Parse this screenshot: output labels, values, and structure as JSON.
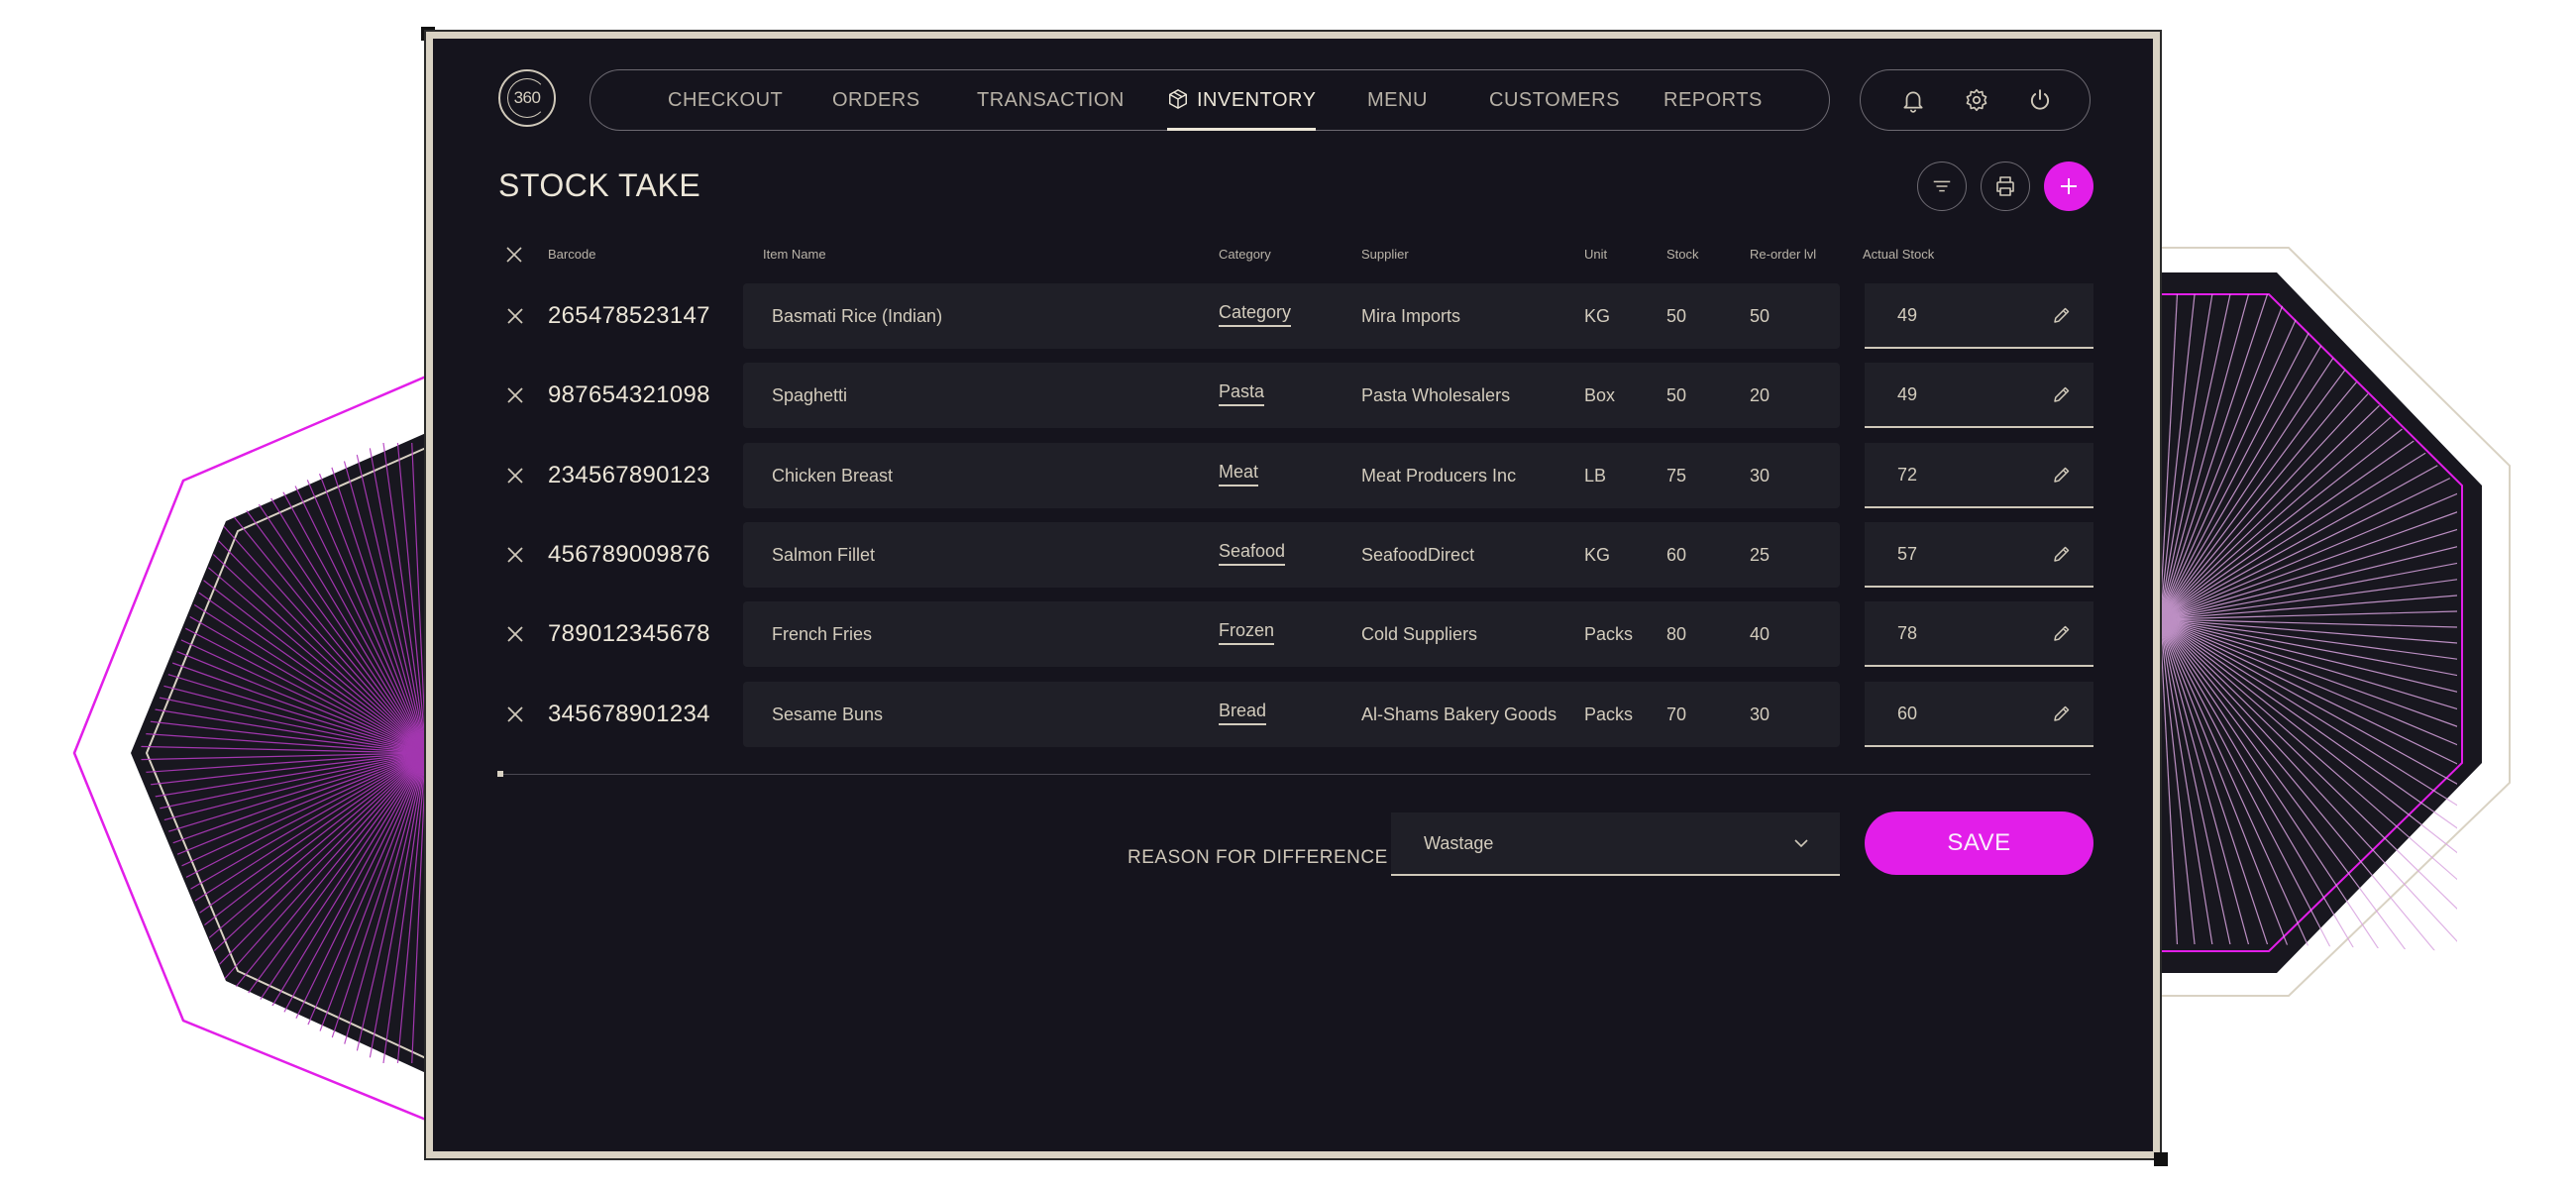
{
  "app": {
    "logo_text": "360"
  },
  "nav": {
    "items": [
      {
        "label": "CHECKOUT",
        "active": false
      },
      {
        "label": "ORDERS",
        "active": false
      },
      {
        "label": "TRANSACTION",
        "active": false
      },
      {
        "label": "INVENTORY",
        "active": true
      },
      {
        "label": "MENU",
        "active": false
      },
      {
        "label": "CUSTOMERS",
        "active": false
      },
      {
        "label": "REPORTS",
        "active": false
      }
    ]
  },
  "header_actions": [
    "bell-icon",
    "gear-icon",
    "power-icon"
  ],
  "page": {
    "title": "STOCK TAKE"
  },
  "toolbar": [
    "filter-icon",
    "printer-icon",
    "plus-icon"
  ],
  "table": {
    "columns": {
      "barcode": "Barcode",
      "item_name": "Item Name",
      "category": "Category",
      "supplier": "Supplier",
      "unit": "Unit",
      "stock": "Stock",
      "reorder": "Re-order lvl",
      "actual": "Actual Stock"
    },
    "rows": [
      {
        "barcode": "265478523147",
        "item_name": "Basmati Rice (Indian)",
        "category": "Category",
        "supplier": "Mira Imports",
        "unit": "KG",
        "stock": "50",
        "reorder": "50",
        "actual": "49"
      },
      {
        "barcode": "987654321098",
        "item_name": "Spaghetti",
        "category": "Pasta",
        "supplier": "Pasta Wholesalers",
        "unit": "Box",
        "stock": "50",
        "reorder": "20",
        "actual": "49"
      },
      {
        "barcode": "234567890123",
        "item_name": "Chicken Breast",
        "category": "Meat",
        "supplier": "Meat Producers Inc",
        "unit": "LB",
        "stock": "75",
        "reorder": "30",
        "actual": "72"
      },
      {
        "barcode": "456789009876",
        "item_name": "Salmon Fillet",
        "category": "Seafood",
        "supplier": "SeafoodDirect",
        "unit": "KG",
        "stock": "60",
        "reorder": "25",
        "actual": "57"
      },
      {
        "barcode": "789012345678",
        "item_name": "French Fries",
        "category": "Frozen",
        "supplier": "Cold Suppliers",
        "unit": "Packs",
        "stock": "80",
        "reorder": "40",
        "actual": "78"
      },
      {
        "barcode": "345678901234",
        "item_name": "Sesame Buns",
        "category": "Bread",
        "supplier": "Al-Shams Bakery Goods",
        "unit": "Packs",
        "stock": "70",
        "reorder": "30",
        "actual": "60"
      }
    ]
  },
  "reason": {
    "label": "REASON FOR DIFFERENCE",
    "value": "Wastage"
  },
  "save_label": "SAVE",
  "colors": {
    "accent": "#e21ee9",
    "background": "#15141d",
    "row": "#1f1f27",
    "text": "#d3ccbd",
    "frame": "#d9d2c3"
  }
}
